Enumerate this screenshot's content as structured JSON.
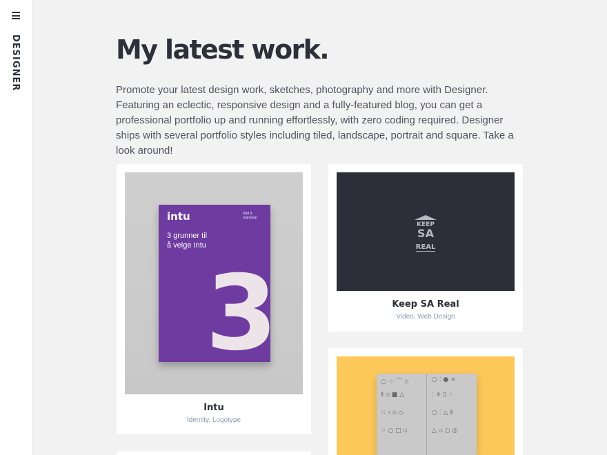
{
  "sidebar": {
    "menu_icon": "hamburger-menu-icon",
    "brand": "DESIGNER"
  },
  "main": {
    "title": "My latest work.",
    "intro": "Promote your latest design work, sketches, photography and more with Designer. Featuring an eclectic, responsive design and a fully-featured blog, you can get a professional portfolio up and running effortlessly, with zero coding required. Designer ships with several portfolio styles including tiled, landscape, portrait and square. Take a look around!"
  },
  "projects": [
    {
      "title": "Intu",
      "categories": [
        "Identity",
        "Logotype"
      ],
      "thumb": {
        "logo": "intu",
        "small": "Råd & regnskap",
        "headline_line1": "3 grunner til",
        "headline_line2": "å velge Intu",
        "big": "3"
      }
    },
    {
      "title": "Keep SA Real",
      "categories": [
        "Video",
        "Web Design"
      ],
      "thumb": {
        "line1": "KEEP",
        "line2": "SA",
        "line3": "REAL"
      }
    },
    {
      "title": "",
      "categories": [],
      "thumb": {}
    }
  ],
  "colors": {
    "background": "#f2f2f2",
    "text_dark": "#2d3039",
    "link": "#8a9cb3",
    "intu_purple": "#6e3ba1",
    "keep_dark": "#2c2f39",
    "yellow": "#fcc85a"
  }
}
